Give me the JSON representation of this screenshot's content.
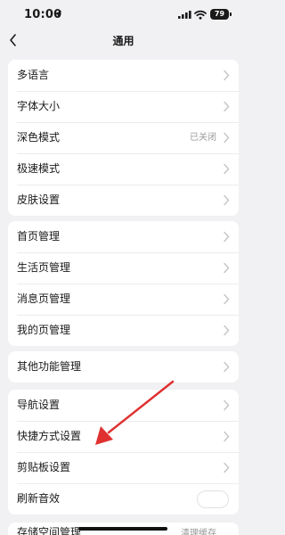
{
  "status_bar": {
    "time": "10:00",
    "battery": "79"
  },
  "nav": {
    "title": "通用"
  },
  "group1": [
    {
      "label": "多语言"
    },
    {
      "label": "字体大小"
    },
    {
      "label": "深色模式",
      "value": "已关闭"
    },
    {
      "label": "极速模式"
    },
    {
      "label": "皮肤设置"
    }
  ],
  "group2": [
    {
      "label": "首页管理"
    },
    {
      "label": "生活页管理"
    },
    {
      "label": "消息页管理"
    },
    {
      "label": "我的页管理"
    }
  ],
  "group3": [
    {
      "label": "其他功能管理"
    }
  ],
  "group4": [
    {
      "label": "导航设置"
    },
    {
      "label": "快捷方式设置"
    },
    {
      "label": "剪贴板设置"
    },
    {
      "label": "刷新音效",
      "toggle_on": false
    }
  ],
  "group5": [
    {
      "label": "存储空间管理",
      "value": "清理缓存"
    }
  ],
  "colors": {
    "annotation_arrow": "#e03131",
    "background": "#f1f1f3"
  }
}
